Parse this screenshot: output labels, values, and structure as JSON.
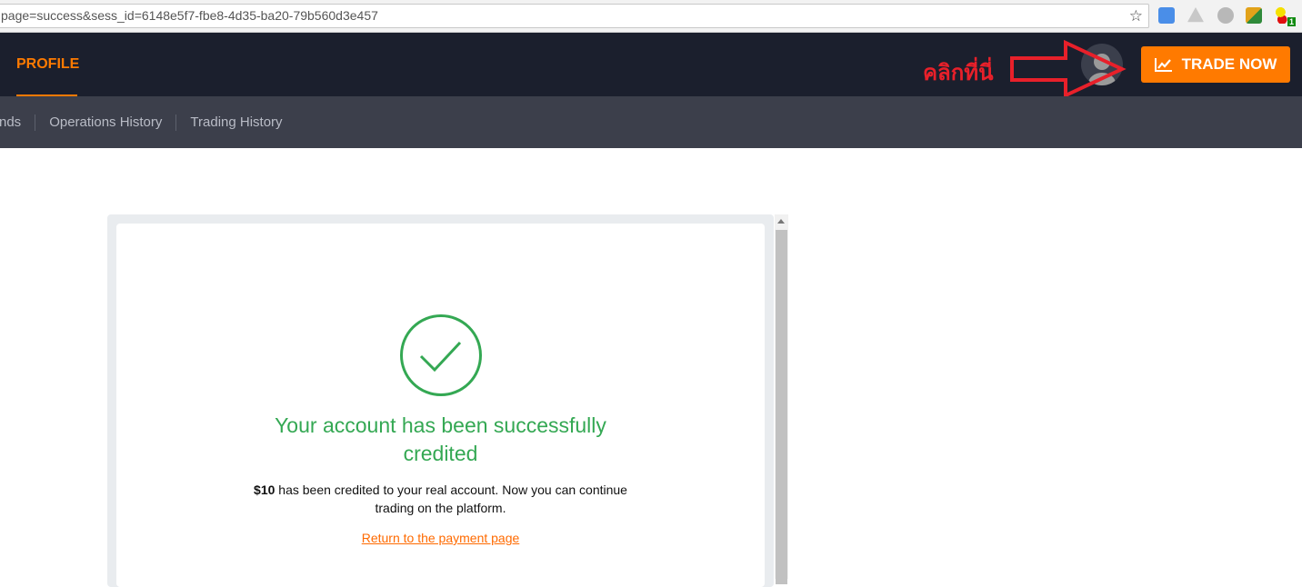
{
  "browser": {
    "url": "page=success&sess_id=6148e5f7-fbe8-4d35-ba20-79b560d3e457",
    "extension_badge": "1"
  },
  "nav": {
    "profile": "PROFILE",
    "annotation": "คลิกที่นี่",
    "trade_button": "TRADE NOW",
    "accent": "#ff7a00"
  },
  "subnav": {
    "items": [
      "nds",
      "Operations History",
      "Trading History"
    ]
  },
  "success": {
    "title_line1": "Your account has been successfully",
    "title_line2": "credited",
    "amount": "$10",
    "message": " has been credited to your real account. Now you can continue trading on the platform.",
    "link": "Return to the payment page",
    "color": "#34a853"
  }
}
